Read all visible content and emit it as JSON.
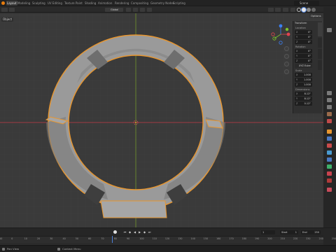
{
  "topbar": {
    "workspaces": [
      "Layout",
      "Modeling",
      "Sculpting",
      "UV Editing",
      "Texture Paint",
      "Shading",
      "Animation",
      "Rendering",
      "Compositing",
      "Geometry Nodes",
      "Scripting"
    ],
    "active_workspace": "Layout",
    "scene_name": "Scene"
  },
  "header": {
    "orientation_label": "Global",
    "options_label": "Options"
  },
  "viewport": {
    "mode_label": "Object",
    "colors": {
      "background": "#3a3a3a",
      "grid": "#414141",
      "axis_x": "#a23a44",
      "axis_y": "#6b8b2f",
      "mesh_fill": "#9a9a9a",
      "selection_outline": "#e8962f"
    }
  },
  "navigation_gizmo": {
    "x_label": "X",
    "y_label": "Y",
    "z_label": "Z",
    "colors": {
      "x": "#e2444f",
      "y": "#7fc32c",
      "z": "#3b7ff2"
    }
  },
  "npanel": {
    "title": "Transform",
    "location": {
      "label": "Location",
      "x": "0\"",
      "y": "0\"",
      "z": "0\""
    },
    "rotation": {
      "label": "Rotation",
      "x": "0°",
      "y": "0°",
      "z": "0°"
    },
    "rotation_mode": "XYZ Euler",
    "scale": {
      "label": "Scale",
      "x": "1.000",
      "y": "1.000",
      "z": "1.000"
    },
    "dimensions": {
      "label": "Dimensions",
      "x": "8.12\"",
      "y": "8.12\"",
      "z": "0.12\""
    },
    "tabs": [
      "Item",
      "Tool",
      "View",
      "Edit"
    ]
  },
  "timeline": {
    "current_frame": "1",
    "start_label": "Start",
    "start_value": "1",
    "end_label": "End",
    "end_value": "250",
    "ruler_ticks": [
      "-10",
      "0",
      "10",
      "20",
      "30",
      "40",
      "50",
      "60",
      "70",
      "80",
      "90",
      "100",
      "110",
      "120",
      "130",
      "140",
      "150",
      "160",
      "170",
      "180",
      "190",
      "200",
      "210",
      "220",
      "230",
      "240",
      "250"
    ]
  },
  "statusbar": {
    "left_item": "Pan View",
    "middle_item": "Context Menu"
  }
}
